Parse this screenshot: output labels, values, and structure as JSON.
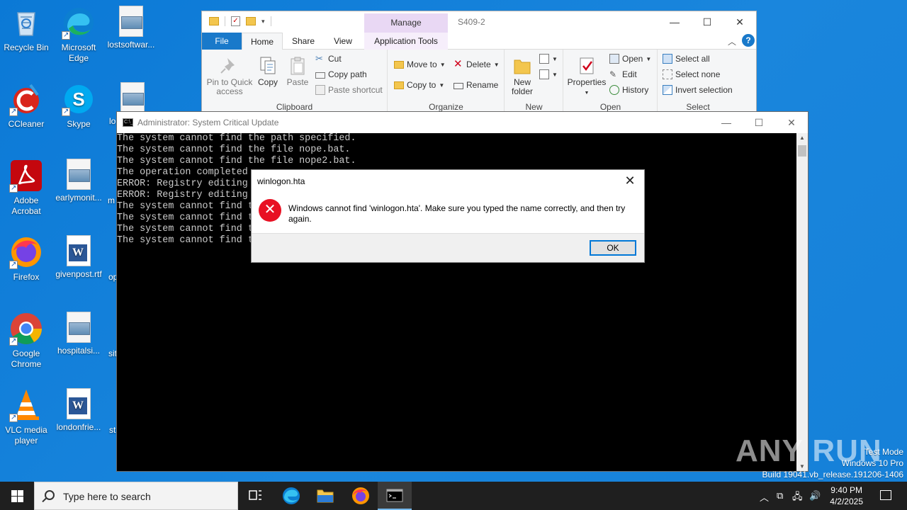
{
  "desktop": {
    "icons": [
      {
        "label": "Recycle Bin"
      },
      {
        "label": "Microsoft Edge"
      },
      {
        "label": "lostsoftwar..."
      },
      {
        "label": "CCleaner"
      },
      {
        "label": "Skype"
      },
      {
        "label": "lo"
      },
      {
        "label": "Adobe Acrobat"
      },
      {
        "label": "earlymonit..."
      },
      {
        "label": "m"
      },
      {
        "label": "Firefox"
      },
      {
        "label": "givenpost.rtf"
      },
      {
        "label": "op"
      },
      {
        "label": "Google Chrome"
      },
      {
        "label": "hospitalsi..."
      },
      {
        "label": "sit"
      },
      {
        "label": "VLC media player"
      },
      {
        "label": "londonfrie..."
      },
      {
        "label": "st"
      }
    ]
  },
  "explorer": {
    "title": "S409-2",
    "contextual_tab": "Manage",
    "tabs": {
      "file": "File",
      "home": "Home",
      "share": "Share",
      "view": "View",
      "app_tools": "Application Tools"
    },
    "clipboard": {
      "pin": "Pin to Quick access",
      "copy": "Copy",
      "paste": "Paste",
      "cut": "Cut",
      "copy_path": "Copy path",
      "paste_shortcut": "Paste shortcut",
      "group": "Clipboard"
    },
    "organize": {
      "move_to": "Move to",
      "copy_to": "Copy to",
      "delete": "Delete",
      "rename": "Rename",
      "group": "Organize"
    },
    "new": {
      "new_folder": "New folder",
      "group": "New"
    },
    "open": {
      "properties": "Properties",
      "open": "Open",
      "edit": "Edit",
      "history": "History",
      "group": "Open"
    },
    "select": {
      "select_all": "Select all",
      "select_none": "Select none",
      "invert": "Invert selection",
      "group": "Select"
    }
  },
  "cmd": {
    "title": "Administrator:  System Critical Update",
    "lines": [
      "The system cannot find the path specified.",
      "The system cannot find the file nope.bat.",
      "The system cannot find the file nope2.bat.",
      "The operation completed",
      "ERROR: Registry editing",
      "ERROR: Registry editing",
      "The system cannot find t",
      "The system cannot find t",
      "The system cannot find t",
      "The system cannot find t"
    ]
  },
  "dialog": {
    "title": "winlogon.hta",
    "message": "Windows cannot find 'winlogon.hta'. Make sure you typed the name correctly, and then try again.",
    "ok": "OK"
  },
  "watermark": {
    "brand": "ANY RUN",
    "test_mode": "Test Mode",
    "edition": "Windows 10 Pro",
    "build": "Build 19041.vb_release.191206-1406"
  },
  "taskbar": {
    "search_placeholder": "Type here to search",
    "time": "9:40 PM",
    "date": "4/2/2025"
  }
}
